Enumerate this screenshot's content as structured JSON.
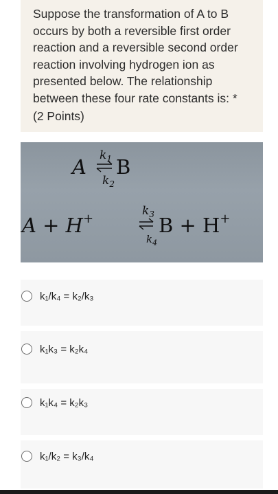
{
  "question": {
    "text": "Suppose the transformation of A to B occurs by both a reversible first order reaction and a reversible second order reaction involving hydrogen ion as presented below. The relationship between these four rate constants is:",
    "required_marker": "*",
    "points": "(2 Points)"
  },
  "equation_image": {
    "reaction1": {
      "left": "A",
      "right": "B",
      "k_forward": "k",
      "k_forward_sub": "1",
      "k_reverse": "k",
      "k_reverse_sub": "2"
    },
    "reaction2": {
      "left": "A + H",
      "left_sup": "+",
      "right": "B + H",
      "right_sup": "+",
      "k_forward": "k",
      "k_forward_sub": "3",
      "k_reverse": "k",
      "k_reverse_sub": "4"
    }
  },
  "options": [
    {
      "label": "k₁/k₄ = k₂/k₃"
    },
    {
      "label": "k₁k₃ = k₂k₄"
    },
    {
      "label": "k₁k₄ = k₂k₃"
    },
    {
      "label": "k₁/k₂ = k₃/k₄"
    }
  ]
}
